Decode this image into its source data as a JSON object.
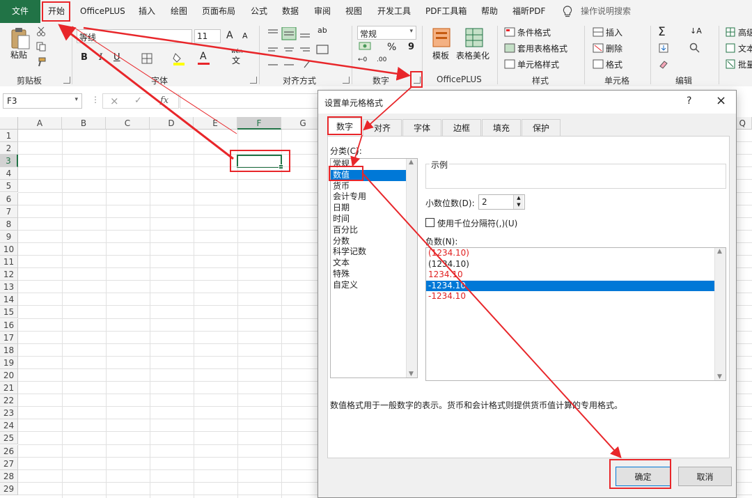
{
  "colors": {
    "excel_green": "#217346",
    "annotation_red": "#e8262a",
    "select_blue": "#0078d7",
    "negative_red": "#e02020"
  },
  "menubar": {
    "file": "文件",
    "items": [
      "开始",
      "OfficePLUS",
      "插入",
      "绘图",
      "页面布局",
      "公式",
      "数据",
      "审阅",
      "视图",
      "开发工具",
      "PDF工具箱",
      "帮助",
      "福昕PDF"
    ],
    "search_icon": "lightbulb-icon",
    "search": "操作说明搜索"
  },
  "ribbon": {
    "clipboard": {
      "paste": "粘贴",
      "label": "剪贴板"
    },
    "font": {
      "name": "等线",
      "size": "11",
      "bold": "B",
      "italic": "I",
      "underline": "U",
      "grow": "A",
      "shrink": "A",
      "color_a": "A",
      "wen": "wén",
      "wen_char": "文",
      "label": "字体"
    },
    "align": {
      "label": "对齐方式",
      "wrap": "ab"
    },
    "number": {
      "format": "常规",
      "percent": "%",
      "comma": "9",
      "inc_decimals": ".00",
      "dec_decimals": "←0",
      "label": "数字"
    },
    "officeplus": {
      "template": "模板",
      "beautify": "表格美化",
      "label": "OfficePLUS"
    },
    "styles": {
      "conditional": "条件格式",
      "table": "套用表格格式",
      "cell": "单元格样式",
      "label": "样式"
    },
    "cells": {
      "insert": "插入",
      "delete": "删除",
      "format": "格式",
      "label": "单元格"
    },
    "edit": {
      "label": "编辑"
    },
    "extra": {
      "advanced": "高级",
      "text": "文本",
      "batch": "批量"
    }
  },
  "formula": {
    "namebox": "F3",
    "fx": "fx"
  },
  "sheet": {
    "columns": [
      "A",
      "B",
      "C",
      "D",
      "E",
      "F",
      "G",
      "Q"
    ],
    "rows": [
      "1",
      "2",
      "3",
      "4",
      "5",
      "6",
      "7",
      "8",
      "9",
      "10",
      "11",
      "12",
      "13",
      "14",
      "15",
      "16",
      "17",
      "18",
      "19",
      "20",
      "21",
      "22",
      "23",
      "24",
      "25",
      "26",
      "27",
      "28",
      "29"
    ]
  },
  "dialog": {
    "title": "设置单元格格式",
    "help": "?",
    "close": "×",
    "tabs": [
      "数字",
      "对齐",
      "字体",
      "边框",
      "填充",
      "保护"
    ],
    "category_label": "分类(C):",
    "categories": [
      "常规",
      "数值",
      "货币",
      "会计专用",
      "日期",
      "时间",
      "百分比",
      "分数",
      "科学记数",
      "文本",
      "特殊",
      "自定义"
    ],
    "selected_category": "数值",
    "sample_label": "示例",
    "decimals_label": "小数位数(D):",
    "decimals_value": "2",
    "thousands_label": "使用千位分隔符(,)(U)",
    "negative_label": "负数(N):",
    "negatives": [
      {
        "text": "(1234.10)",
        "color": "#e02020"
      },
      {
        "text": "(1234.10)",
        "color": "#222222"
      },
      {
        "text": "1234.10",
        "color": "#e02020"
      },
      {
        "text": "-1234.10",
        "color": "#ffffff"
      },
      {
        "text": "-1234.10",
        "color": "#e02020"
      }
    ],
    "description": "数值格式用于一般数字的表示。货币和会计格式则提供货币值计算的专用格式。",
    "ok": "确定",
    "cancel": "取消"
  }
}
